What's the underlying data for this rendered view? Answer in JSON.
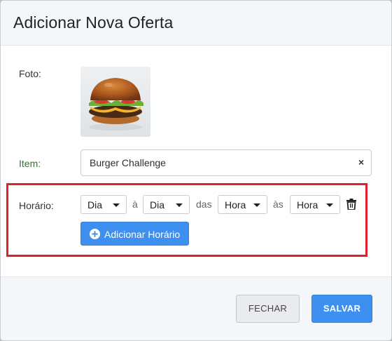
{
  "modal": {
    "title": "Adicionar Nova Oferta"
  },
  "form": {
    "photo_label": "Foto:",
    "item_label": "Item:",
    "item_value": "Burger Challenge",
    "item_clear": "×",
    "schedule_label": "Horário:",
    "schedule": {
      "day_from": "Dia",
      "sep1": "à",
      "day_to": "Dia",
      "sep2": "das",
      "hour_from": "Hora",
      "sep3": "às",
      "hour_to": "Hora"
    },
    "add_schedule_label": "Adicionar Horário"
  },
  "footer": {
    "close_label": "FECHAR",
    "save_label": "SALVAR"
  },
  "colors": {
    "primary": "#3d8ff0",
    "highlight": "#e0202a",
    "item_label": "#3d6b3a"
  },
  "icons": {
    "add": "plus-circle-icon",
    "delete": "trash-icon",
    "select": "caret-down-icon"
  }
}
